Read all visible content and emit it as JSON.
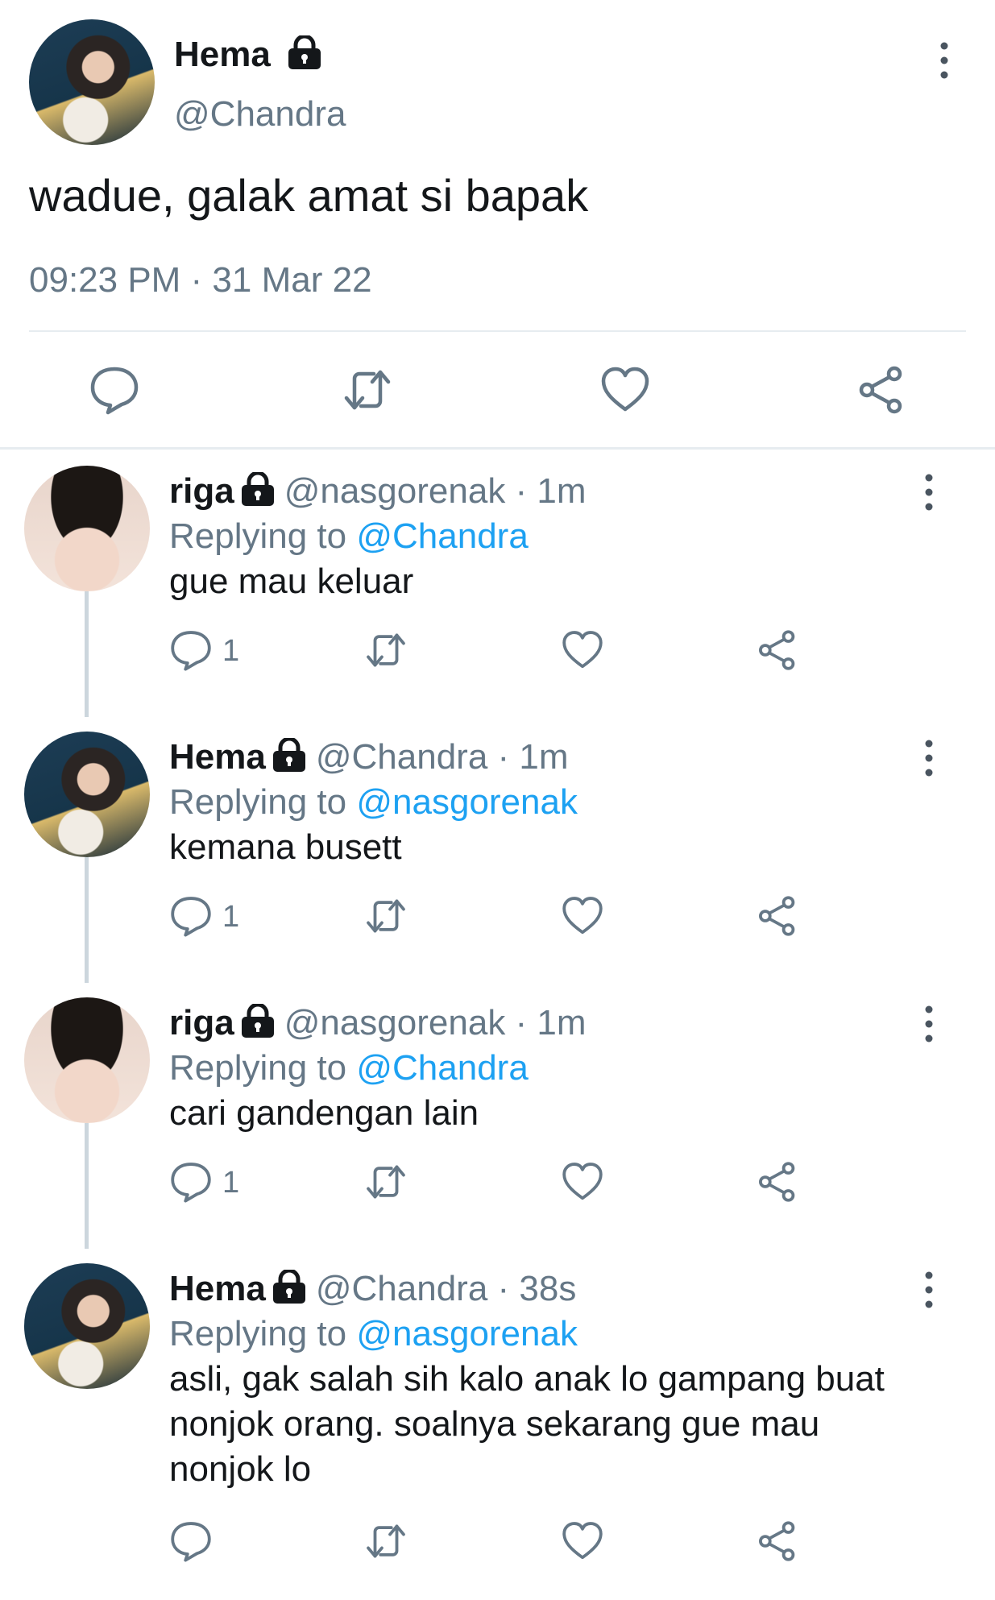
{
  "main_tweet": {
    "name": "Hema",
    "handle": "@Chandra",
    "text": "wadue, galak amat si bapak",
    "timestamp": "09:23 PM · 31 Mar 22",
    "actions": [
      "reply-icon",
      "retweet-icon",
      "like-icon",
      "share-icon"
    ]
  },
  "replies": [
    {
      "name": "riga",
      "handle": "@nasgorenak · 1m",
      "replying_prefix": "Replying to ",
      "replying_to": "@Chandra",
      "text": "gue mau keluar",
      "reply_count": "1"
    },
    {
      "name": "Hema",
      "handle": "@Chandra · 1m",
      "replying_prefix": "Replying to ",
      "replying_to": "@nasgorenak",
      "text": "kemana busett",
      "reply_count": "1"
    },
    {
      "name": "riga",
      "handle": "@nasgorenak · 1m",
      "replying_prefix": "Replying to ",
      "replying_to": "@Chandra",
      "text": "cari gandengan lain",
      "reply_count": "1"
    },
    {
      "name": "Hema",
      "handle": "@Chandra · 38s",
      "replying_prefix": "Replying to ",
      "replying_to": "@nasgorenak",
      "text": "asli, gak salah sih kalo anak lo gampang buat nonjok orang. soalnya sekarang gue mau nonjok lo",
      "reply_count": ""
    }
  ],
  "colors": {
    "link": "#1da1f2",
    "secondary_text": "#657786",
    "primary_text": "#14171a",
    "divider": "#e6ecf0"
  }
}
